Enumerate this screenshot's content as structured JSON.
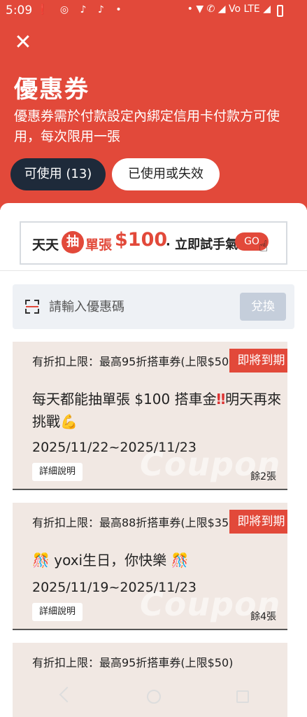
{
  "status_bar": {
    "time": "5:09",
    "left_icons": "❗ ◎ ♪ ♪ •",
    "right_icons": "• ▼ ✆ ◢ Vo LTE ◢"
  },
  "header": {
    "close_icon": "✕",
    "title": "優惠券",
    "description": "優惠券需於付款設定內綁定信用卡付款方可使用，每次限用一張"
  },
  "tabs": [
    {
      "label": "可使用 (13)",
      "active": true
    },
    {
      "label": "已使用或失效",
      "active": false
    }
  ],
  "promo": {
    "text1": "天天",
    "lottery_badge": "抽",
    "text2": "單張",
    "amount": "$100",
    "text3": "· 立即試手氣",
    "go_label": "GO",
    "hand_icon": "☝"
  },
  "code_entry": {
    "placeholder": "請輸入優惠碼",
    "redeem_label": "兌換"
  },
  "coupons": [
    {
      "limit": "有折扣上限：最高95折搭車券(上限$50)",
      "title_text": "每天都能抽單張 $100 搭車金",
      "title_mark": "‼",
      "title_text2": "明天再來挑戰",
      "title_emoji": "💪",
      "dates": "2025/11/22~2025/11/23",
      "detail_label": "詳細說明",
      "remaining": "餘2張",
      "badge": "即將到期",
      "watermark": "Coupon"
    },
    {
      "limit": "有折扣上限：最高88折搭車券(上限$35)",
      "title_emoji": "🎊",
      "title_text": "yoxi生日，你快樂",
      "dates": "2025/11/19~2025/11/23",
      "detail_label": "詳細說明",
      "remaining": "餘4張",
      "badge": "即將到期",
      "watermark": "Coupon"
    },
    {
      "limit": "有折扣上限：最高95折搭車券(上限$50)"
    }
  ],
  "colors": {
    "brand_red": "#e2493a",
    "tab_active_bg": "#1e2a3a",
    "coupon_bg": "#f1e8e3",
    "redeem_disabled": "#c5cedb"
  }
}
